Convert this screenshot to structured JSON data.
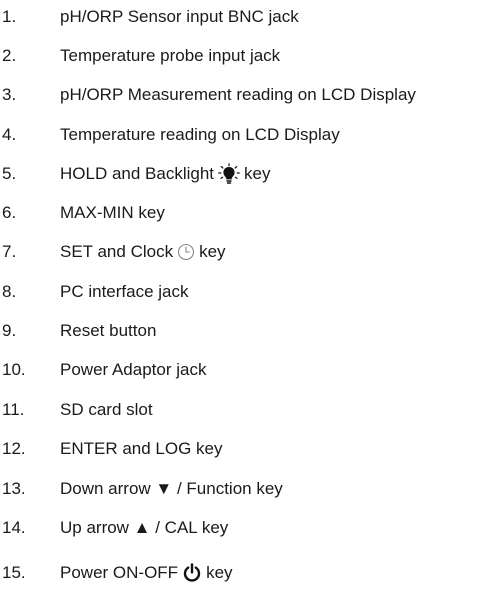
{
  "items": [
    {
      "num": "1.",
      "text": "pH/ORP Sensor input BNC jack"
    },
    {
      "num": "2.",
      "text": "Temperature probe input jack"
    },
    {
      "num": "3.",
      "text": "pH/ORP Measurement reading on LCD Display"
    },
    {
      "num": "4.",
      "text": "Temperature reading on LCD Display"
    },
    {
      "num": "5.",
      "text": "HOLD and Backlight",
      "after": "key",
      "icon": "lightbulb-icon"
    },
    {
      "num": "6.",
      "text": "MAX-MIN key"
    },
    {
      "num": "7.",
      "text": "SET and Clock",
      "after": "key",
      "icon": "clock-icon"
    },
    {
      "num": "8.",
      "text": "PC interface jack"
    },
    {
      "num": "9.",
      "text": "Reset button"
    },
    {
      "num": "10.",
      "text": "Power Adaptor jack"
    },
    {
      "num": "11.",
      "text": "SD card slot"
    },
    {
      "num": "12.",
      "text": "ENTER and LOG key"
    },
    {
      "num": "13.",
      "text": "Down arrow ▼ / Function key"
    },
    {
      "num": "14.",
      "text": "Up arrow ▲ / CAL key"
    },
    {
      "num": "15.",
      "text": "Power ON-OFF",
      "after": "key",
      "icon": "power-icon"
    }
  ]
}
